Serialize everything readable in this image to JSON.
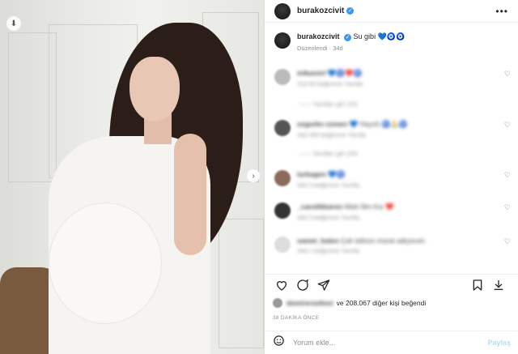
{
  "post": {
    "username": "burakozcivit",
    "more_icon": "more-horizontal-icon",
    "caption_text": "Su gibi 💙🧿🧿",
    "edited_label": "Düzenlendi · 34d"
  },
  "comments": [
    {
      "user": "m4uemrl",
      "text": "💙🧿❤️🧿",
      "meta": "31d  93 beğenme  Yanıtla",
      "replies": "—— Yanıtları gör (15)"
    },
    {
      "user": "ozgurkn ozmen",
      "text": "💙 Hayırlı 🧿🙏🧿",
      "meta": "34d  499 beğenme  Yanıtla",
      "replies": "—— Yanıtları gör (24)"
    },
    {
      "user": "turkagen",
      "text": "💙🧿",
      "meta": "34d  3 beğenme  Yanıtla",
      "replies": ""
    },
    {
      "user": "_cacelikkaren",
      "text": "Allah İlim Kıs ❤️",
      "meta": "34d  3 beğenme  Yanıtla",
      "replies": ""
    },
    {
      "user": "samet_bates",
      "text": "Çok tatlısın murat adiyorum",
      "meta": "34d  1 beğenme  Yanıtla",
      "replies": ""
    }
  ],
  "likes": {
    "liker": "demirerseltesi",
    "rest": "ve 208.067 diğer kişi beğendi"
  },
  "timestamp": "38 DAKİKA ÖNCE",
  "comment_box": {
    "placeholder": "Yorum ekle...",
    "post_label": "Paylaş"
  }
}
